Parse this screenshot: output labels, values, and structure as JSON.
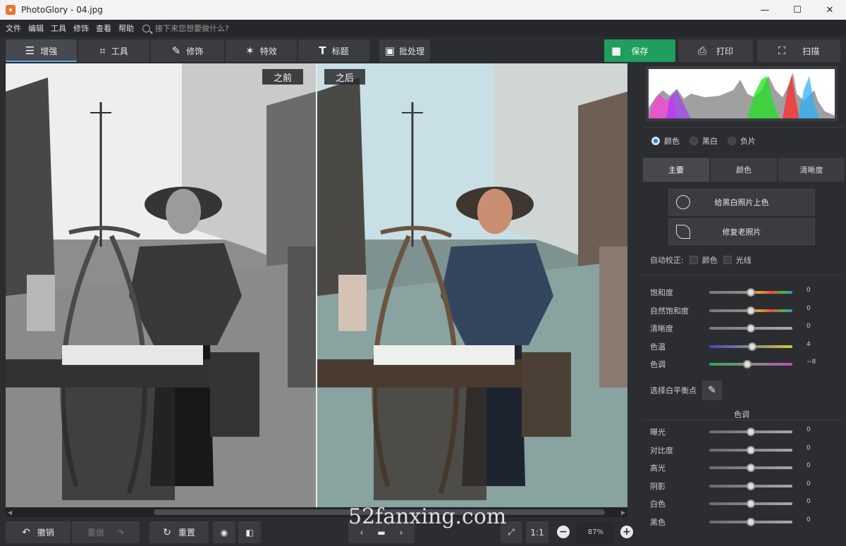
{
  "window": {
    "title": "PhotoGlory - 04.jpg",
    "controls": [
      "—",
      "☐",
      "✕"
    ]
  },
  "menu": {
    "items": [
      "文件",
      "编辑",
      "工具",
      "修饰",
      "查看",
      "帮助"
    ],
    "search_placeholder": "接下来您想要做什么?"
  },
  "toolbar": {
    "tabs": [
      {
        "label": "增强",
        "icon": "sliders-icon"
      },
      {
        "label": "工具",
        "icon": "crop-icon"
      },
      {
        "label": "修饰",
        "icon": "brush-icon"
      },
      {
        "label": "特效",
        "icon": "magic-wand-icon"
      },
      {
        "label": "标题",
        "icon": "text-icon"
      }
    ],
    "batch": "批处理",
    "save": "保存",
    "print": "打印",
    "scan": "扫描"
  },
  "compare": {
    "before": "之前",
    "after": "之后"
  },
  "bottom": {
    "undo": "撤销",
    "redo": "重做",
    "reset": "重置",
    "ratio": "1:1",
    "zoom": "87%",
    "watermark": "52fanxing.com"
  },
  "panel": {
    "modes": [
      "颜色",
      "黑白",
      "负片"
    ],
    "selected_mode": "颜色",
    "tabs": [
      "主要",
      "颜色",
      "清晰度"
    ],
    "colorize_button": "给黑白照片上色",
    "restore_button": "修复老照片",
    "auto_correct": {
      "label": "自动校正:",
      "options": [
        "颜色",
        "光线"
      ]
    },
    "sliders_top": [
      {
        "label": "饱和度",
        "value": "0",
        "level": 0.5
      },
      {
        "label": "自然饱和度",
        "value": "0",
        "level": 0.5
      },
      {
        "label": "清晰度",
        "value": "0",
        "level": 0.5
      },
      {
        "label": "色温",
        "value": "4",
        "level": 0.52
      },
      {
        "label": "色调",
        "value": "−8",
        "level": 0.46
      }
    ],
    "white_balance": "选择白平衡点",
    "tone_section": "色调",
    "sliders_tone": [
      {
        "label": "曝光",
        "value": "0",
        "level": 0.5
      },
      {
        "label": "对比度",
        "value": "0",
        "level": 0.5
      },
      {
        "label": "高光",
        "value": "0",
        "level": 0.5
      },
      {
        "label": "阴影",
        "value": "0",
        "level": 0.5
      },
      {
        "label": "白色",
        "value": "0",
        "level": 0.5
      },
      {
        "label": "黑色",
        "value": "0",
        "level": 0.5
      }
    ]
  },
  "colors": {
    "accent_blue": "#2f7fd6",
    "save_green": "#1f9e5e"
  }
}
